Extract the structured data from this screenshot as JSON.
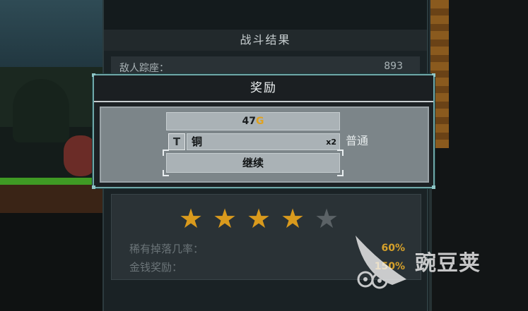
{
  "back_panel": {
    "title": "战斗结果",
    "enemy_label": "敌人踪座：",
    "enemy_value": "893",
    "stars": {
      "filled": 4,
      "total": 5,
      "filled_color": "#d99a1d",
      "empty_color": "#5b6266"
    },
    "rare_drop_label": "稀有掉落几率：",
    "rare_drop_value": "60%",
    "money_reward_label": "金钱奖励：",
    "money_reward_value": "150%"
  },
  "reward_dialog": {
    "title": "奖励",
    "gold_amount": "47",
    "gold_suffix": "G",
    "item_icon": "hammer-icon",
    "item_icon_glyph": "T",
    "item_name": "铜",
    "item_quantity": "x2",
    "item_rarity": "普通",
    "continue_label": "继续"
  },
  "watermark": {
    "text": "豌豆荚"
  }
}
